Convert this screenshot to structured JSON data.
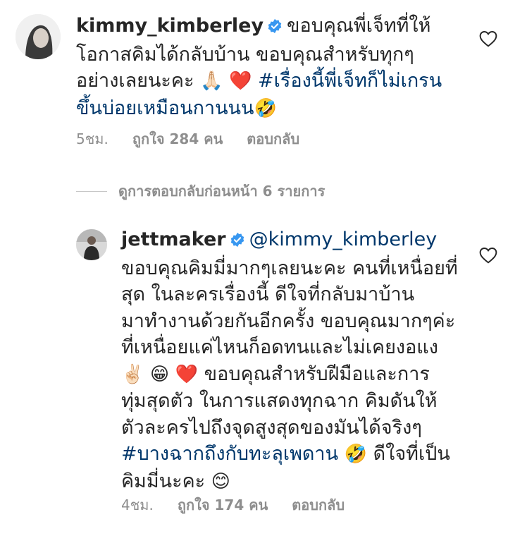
{
  "comments": [
    {
      "username": "kimmy_kimberley",
      "text_1": "ขอบคุณพี่เจ็ทที่ให้",
      "text_2": "โอกาสคิมได้กลับบ้าน ขอบคุณสำหรับทุกๆ",
      "text_3": "อย่างเลยนะคะ",
      "emoji_1": "🙏🏻",
      "emoji_2": "❤️",
      "hashtag_1": "#เรื่องนี้พี่เจ็ทก็ไม่เกรน",
      "hashtag_2": "ขึ้นบ่อยเหมือนกานนน",
      "emoji_3": "🤣",
      "time": "5ชม.",
      "likes": "ถูกใจ 284 คน",
      "reply": "ตอบกลับ"
    }
  ],
  "view_replies": "ดูการตอบกลับก่อนหน้า 6 รายการ",
  "reply_comment": {
    "username": "jettmaker",
    "mention": "@kimmy_kimberley",
    "line_1": "ขอบคุณคิมมี่มากๆเลยนะคะ คนที่เหนื่อยที่",
    "line_2": "สุด ในละครเรื่องนี้ ดีใจที่กลับมาบ้าน",
    "line_3": "มาทำงานด้วยกันอีกครั้ง ขอบคุณมากๆค่ะ",
    "line_4": "ที่เหนื่อยแค่ไหนก็อดทนและไม่เคยงอแง",
    "emoji_1": "✌🏻",
    "emoji_2": "😁",
    "emoji_3": "❤️",
    "line_5": "ขอบคุณสำหรับฝีมือและการ",
    "line_6": "ทุ่มสุดตัว ในการแสดงทุกฉาก คิมดันให้",
    "line_7": "ตัวละครไปถึงจุดสูงสุดของมันได้จริงๆ",
    "hashtag": "#บางฉากถึงกับทะลุเพดาน",
    "emoji_4": "🤣",
    "line_8": "ดีใจที่เป็น",
    "line_9": "คิมมี่นะคะ",
    "emoji_5": "😊",
    "time": "4ชม.",
    "likes": "ถูกใจ 174 คน",
    "reply": "ตอบกลับ"
  },
  "colors": {
    "text": "#262626",
    "meta": "#8e8e8e",
    "link": "#00376b",
    "verified": "#3897f0"
  }
}
